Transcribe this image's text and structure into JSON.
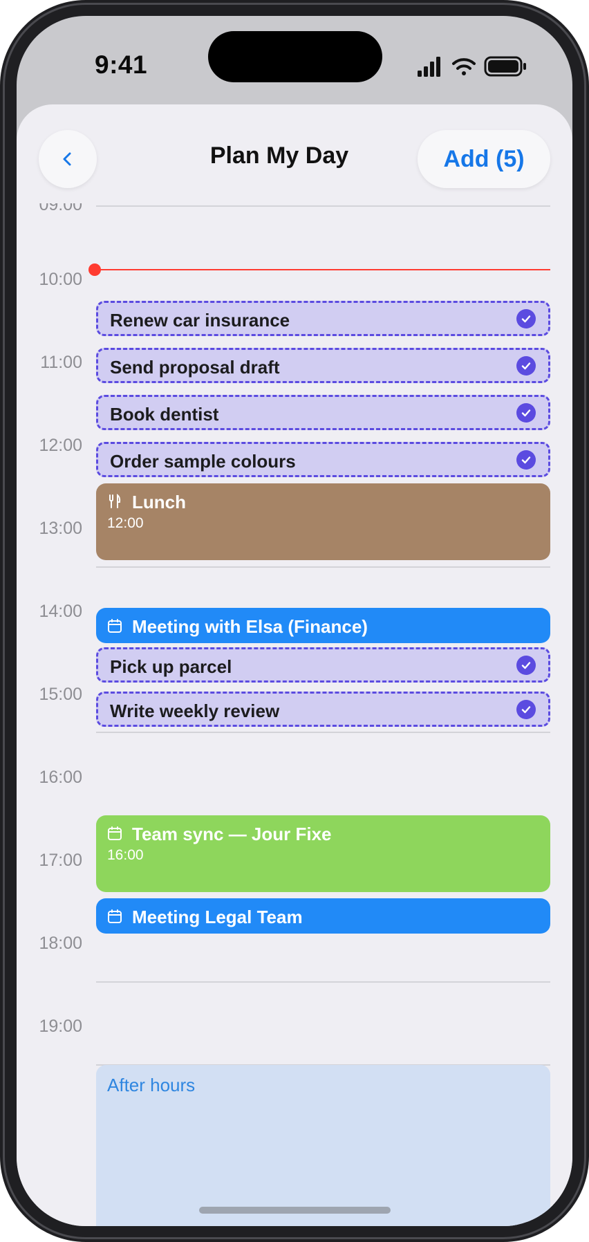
{
  "status_bar": {
    "time": "9:41"
  },
  "header": {
    "title": "Plan My Day",
    "add_label": "Add (5)"
  },
  "timeline": {
    "hours": [
      "09:00",
      "10:00",
      "11:00",
      "12:00",
      "13:00",
      "14:00",
      "15:00",
      "16:00",
      "17:00",
      "18:00",
      "19:00"
    ]
  },
  "tasks": [
    {
      "label": "Renew car insurance",
      "checked": true
    },
    {
      "label": "Send proposal draft",
      "checked": true
    },
    {
      "label": "Book dentist",
      "checked": true
    },
    {
      "label": "Order sample colours",
      "checked": true
    },
    {
      "label": "Pick up parcel",
      "checked": true
    },
    {
      "label": "Write weekly review",
      "checked": true
    }
  ],
  "events": {
    "lunch": {
      "title": "Lunch",
      "time": "12:00",
      "color": "#a68466",
      "icon": "fork-knife-icon"
    },
    "elsa": {
      "title": "Meeting with Elsa (Finance)",
      "color": "#218af7",
      "icon": "calendar-icon"
    },
    "team_sync": {
      "title": "Team sync — Jour Fixe",
      "time": "16:00",
      "color": "#8ed65c",
      "icon": "calendar-icon"
    },
    "legal": {
      "title": "Meeting Legal Team",
      "color": "#218af7",
      "icon": "calendar-icon"
    }
  },
  "after_hours": {
    "label": "After hours",
    "color": "#d2dff3"
  },
  "colors": {
    "accent": "#1677e8",
    "task_fill": "#d1cdf2",
    "task_border": "#5b4be0",
    "now_line": "#ff3b30"
  }
}
